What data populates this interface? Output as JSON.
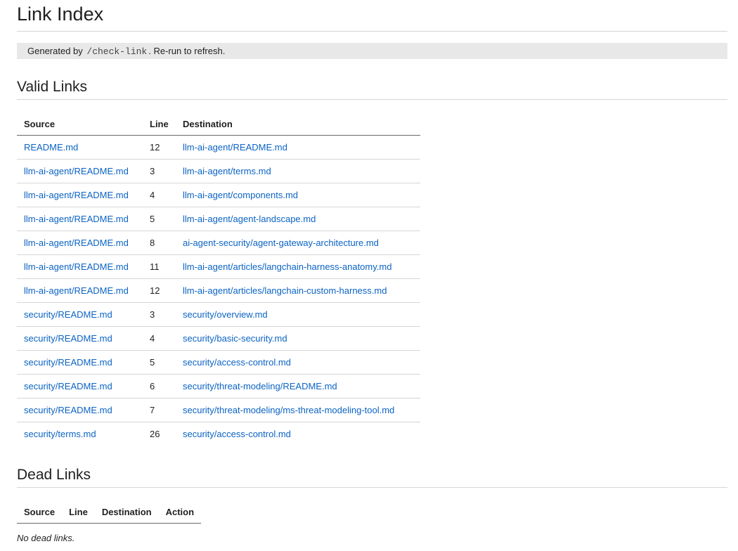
{
  "page": {
    "title": "Link Index",
    "note": {
      "prefix": "Generated by",
      "command": "/check-link",
      "suffix": ". Re-run to refresh."
    }
  },
  "valid_links": {
    "heading": "Valid Links",
    "columns": [
      "Source",
      "Line",
      "Destination"
    ],
    "rows": [
      {
        "source": "README.md",
        "line": "12",
        "destination": "llm-ai-agent/README.md"
      },
      {
        "source": "llm-ai-agent/README.md",
        "line": "3",
        "destination": "llm-ai-agent/terms.md"
      },
      {
        "source": "llm-ai-agent/README.md",
        "line": "4",
        "destination": "llm-ai-agent/components.md"
      },
      {
        "source": "llm-ai-agent/README.md",
        "line": "5",
        "destination": "llm-ai-agent/agent-landscape.md"
      },
      {
        "source": "llm-ai-agent/README.md",
        "line": "8",
        "destination": "ai-agent-security/agent-gateway-architecture.md"
      },
      {
        "source": "llm-ai-agent/README.md",
        "line": "11",
        "destination": "llm-ai-agent/articles/langchain-harness-anatomy.md"
      },
      {
        "source": "llm-ai-agent/README.md",
        "line": "12",
        "destination": "llm-ai-agent/articles/langchain-custom-harness.md"
      },
      {
        "source": "security/README.md",
        "line": "3",
        "destination": "security/overview.md"
      },
      {
        "source": "security/README.md",
        "line": "4",
        "destination": "security/basic-security.md"
      },
      {
        "source": "security/README.md",
        "line": "5",
        "destination": "security/access-control.md"
      },
      {
        "source": "security/README.md",
        "line": "6",
        "destination": "security/threat-modeling/README.md"
      },
      {
        "source": "security/README.md",
        "line": "7",
        "destination": "security/threat-modeling/ms-threat-modeling-tool.md"
      },
      {
        "source": "security/terms.md",
        "line": "26",
        "destination": "security/access-control.md"
      }
    ]
  },
  "dead_links": {
    "heading": "Dead Links",
    "columns": [
      "Source",
      "Line",
      "Destination",
      "Action"
    ],
    "empty_message": "No dead links."
  },
  "colors": {
    "link": "#0b63c4",
    "note_background": "#e8e8e8",
    "rule": "#d6d6d6"
  }
}
